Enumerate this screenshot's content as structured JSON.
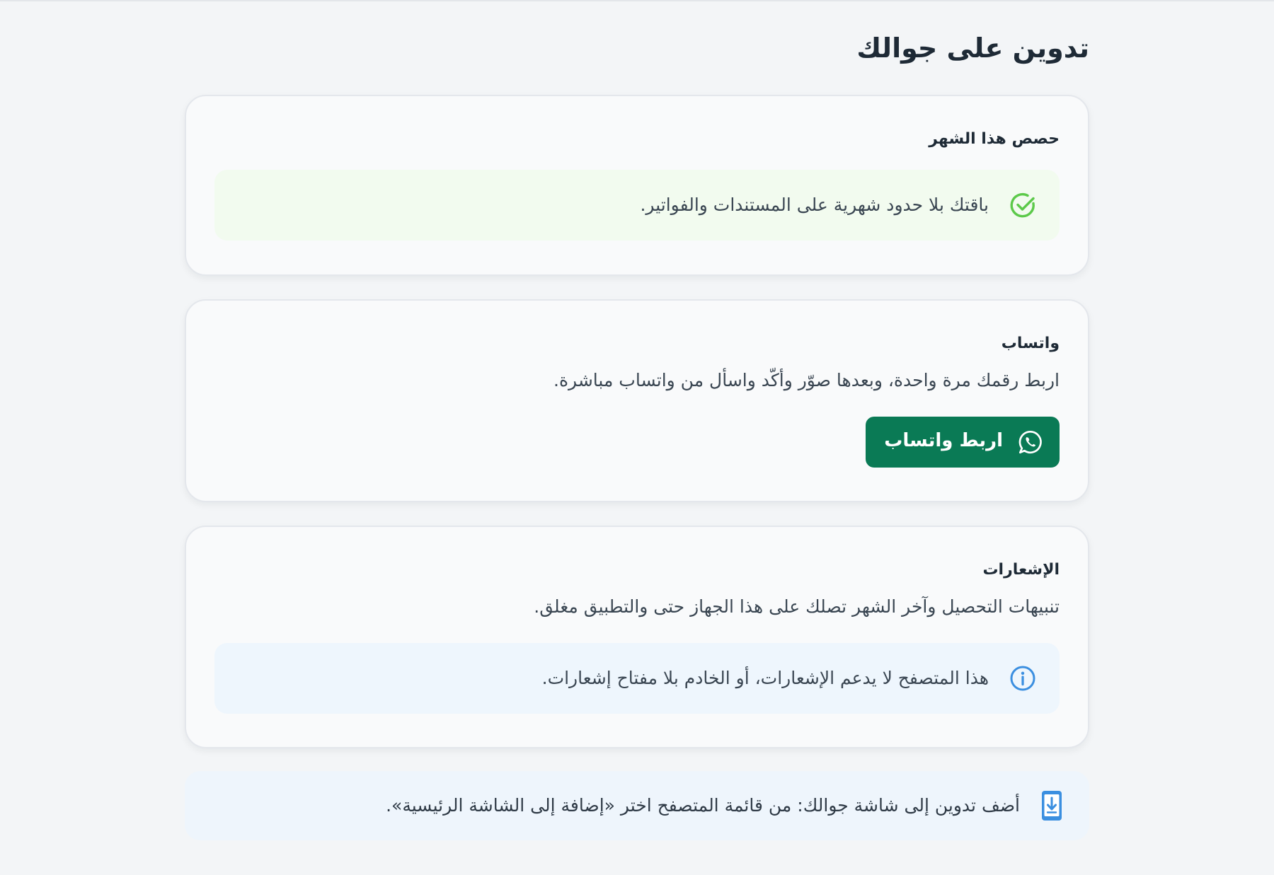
{
  "page": {
    "title": "تدوين على جوالك"
  },
  "usage_card": {
    "heading": "حصص هذا الشهر",
    "alert": {
      "icon": "check-circle-icon",
      "text": "باقتك بلا حدود شهرية على المستندات والفواتير."
    }
  },
  "whatsapp_card": {
    "heading": "واتساب",
    "description": "اربط رقمك مرة واحدة، وبعدها صوّر وأكّد واسأل من واتساب مباشرة.",
    "button": {
      "label": "اربط واتساب",
      "icon": "whatsapp-icon"
    }
  },
  "notifications_card": {
    "heading": "الإشعارات",
    "description": "تنبيهات التحصيل وآخر الشهر تصلك على هذا الجهاز حتى والتطبيق مغلق.",
    "alert": {
      "icon": "info-icon",
      "text": "هذا المتصفح لا يدعم الإشعارات، أو الخادم بلا مفتاح إشعارات."
    }
  },
  "install_banner": {
    "icon": "phone-download-icon",
    "text": "أضف تدوين إلى شاشة جوالك: من قائمة المتصفح اختر «إضافة إلى الشاشة الرئيسية»."
  },
  "colors": {
    "background": "#f3f5f7",
    "card": "#f9fafb",
    "success_bg": "#f2fbef",
    "success_icon": "#5cc94a",
    "info_bg": "#eef6fd",
    "info_icon": "#3b8fe0",
    "whatsapp_button": "#0a7a55",
    "text_dark": "#1e2a36"
  }
}
